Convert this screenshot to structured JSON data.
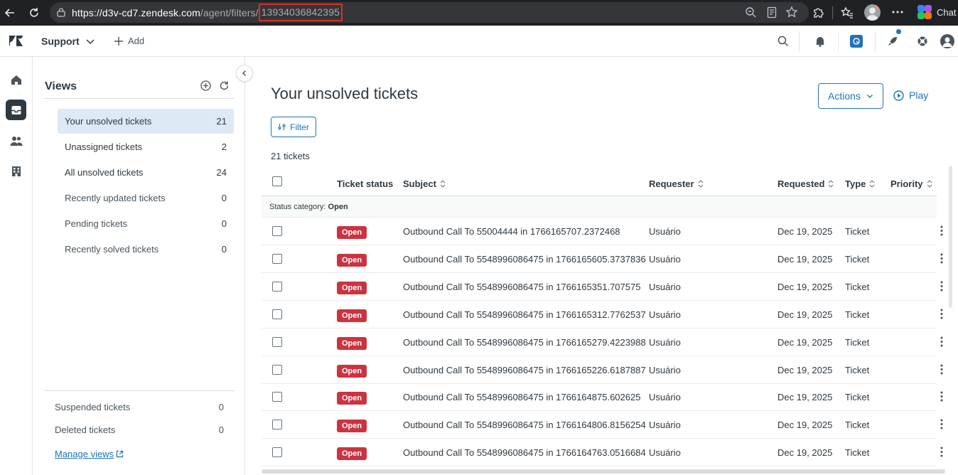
{
  "browser": {
    "url_host": "https://d3v-cd7.zendesk.com",
    "url_path": "/agent/filters/",
    "url_id": "13934036842395",
    "chat_label": "Chat"
  },
  "topbar": {
    "product": "Support",
    "add_label": "Add"
  },
  "views": {
    "title": "Views",
    "items": [
      {
        "label": "Your unsolved tickets",
        "count": "21"
      },
      {
        "label": "Unassigned tickets",
        "count": "2"
      },
      {
        "label": "All unsolved tickets",
        "count": "24"
      },
      {
        "label": "Recently updated tickets",
        "count": "0"
      },
      {
        "label": "Pending tickets",
        "count": "0"
      },
      {
        "label": "Recently solved tickets",
        "count": "0"
      }
    ],
    "bottom": [
      {
        "label": "Suspended tickets",
        "count": "0"
      },
      {
        "label": "Deleted tickets",
        "count": "0"
      }
    ],
    "manage_label": "Manage views"
  },
  "main": {
    "title": "Your unsolved tickets",
    "actions_label": "Actions",
    "play_label": "Play",
    "filter_label": "Filter",
    "ticket_count": "21 tickets",
    "columns": {
      "status": "Ticket status",
      "subject": "Subject",
      "requester": "Requester",
      "requested": "Requested",
      "type": "Type",
      "priority": "Priority"
    },
    "group_prefix": "Status category: ",
    "group_value": "Open",
    "rows": [
      {
        "status": "Open",
        "subject": "Outbound Call To 55004444 in 1766165707.2372468",
        "requester": "Usuário",
        "requested": "Dec 19, 2025",
        "type": "Ticket"
      },
      {
        "status": "Open",
        "subject": "Outbound Call To 5548996086475 in 1766165605.3737836",
        "requester": "Usuário",
        "requested": "Dec 19, 2025",
        "type": "Ticket"
      },
      {
        "status": "Open",
        "subject": "Outbound Call To 5548996086475 in 1766165351.707575",
        "requester": "Usuário",
        "requested": "Dec 19, 2025",
        "type": "Ticket"
      },
      {
        "status": "Open",
        "subject": "Outbound Call To 5548996086475 in 1766165312.7762537",
        "requester": "Usuário",
        "requested": "Dec 19, 2025",
        "type": "Ticket"
      },
      {
        "status": "Open",
        "subject": "Outbound Call To 5548996086475 in 1766165279.4223988",
        "requester": "Usuário",
        "requested": "Dec 19, 2025",
        "type": "Ticket"
      },
      {
        "status": "Open",
        "subject": "Outbound Call To 5548996086475 in 1766165226.6187887",
        "requester": "Usuário",
        "requested": "Dec 19, 2025",
        "type": "Ticket"
      },
      {
        "status": "Open",
        "subject": "Outbound Call To 5548996086475 in 1766164875.602625",
        "requester": "Usuário",
        "requested": "Dec 19, 2025",
        "type": "Ticket"
      },
      {
        "status": "Open",
        "subject": "Outbound Call To 5548996086475 in 1766164806.8156254",
        "requester": "Usuário",
        "requested": "Dec 19, 2025",
        "type": "Ticket"
      },
      {
        "status": "Open",
        "subject": "Outbound Call To 5548996086475 in 1766164763.0516684",
        "requester": "Usuário",
        "requested": "Dec 19, 2025",
        "type": "Ticket"
      }
    ]
  },
  "colors": {
    "accent": "#1f73b7",
    "open_badge": "#cc3340",
    "selected_view": "#dde9f5",
    "url_highlight": "#d93025"
  }
}
